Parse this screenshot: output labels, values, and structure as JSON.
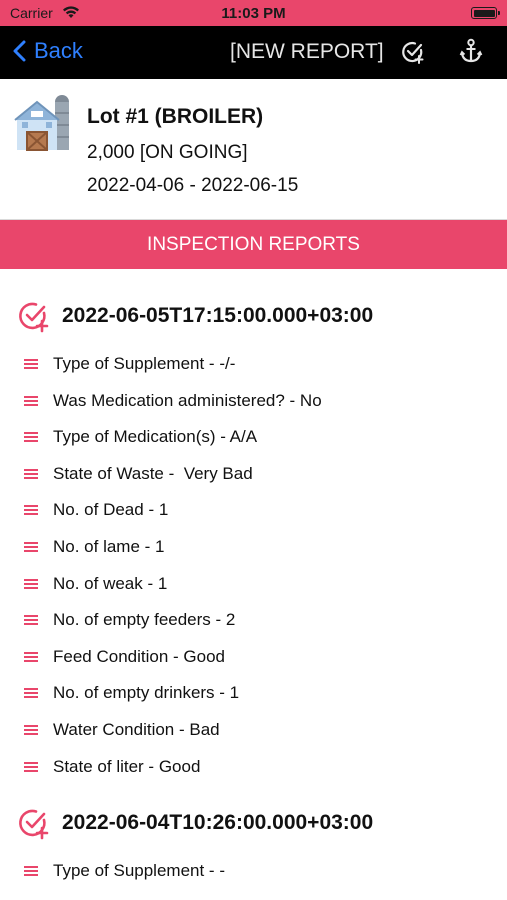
{
  "status_bar": {
    "carrier": "Carrier",
    "time": "11:03 PM",
    "battery_level": 1.0
  },
  "nav": {
    "back_label": "Back",
    "title": "[NEW REPORT]",
    "icons": [
      "check-plus-icon",
      "anchor-icon"
    ]
  },
  "lot": {
    "title": "Lot #1 (BROILER)",
    "count_status": "2,000 [ON GOING]",
    "date_range": "2022-04-06 - 2022-06-15",
    "icon": "farm-barn-icon"
  },
  "section": {
    "title": "INSPECTION REPORTS"
  },
  "colors": {
    "accent": "#e9466b",
    "nav_bg": "#000000",
    "link": "#2f80ff"
  },
  "reports": [
    {
      "timestamp": "2022-06-05T17:15:00.000+03:00",
      "items": [
        "Type of Supplement - -/-",
        "Was Medication administered? - No",
        "Type of Medication(s) - A/A",
        "State of Waste -  Very Bad",
        "No. of Dead - 1",
        "No. of lame - 1",
        "No. of weak - 1",
        "No. of empty feeders - 2",
        "Feed Condition - Good",
        "No. of empty drinkers - 1",
        "Water Condition - Bad",
        "State of liter - Good"
      ]
    },
    {
      "timestamp": "2022-06-04T10:26:00.000+03:00",
      "items": [
        "Type of Supplement - -"
      ]
    }
  ]
}
